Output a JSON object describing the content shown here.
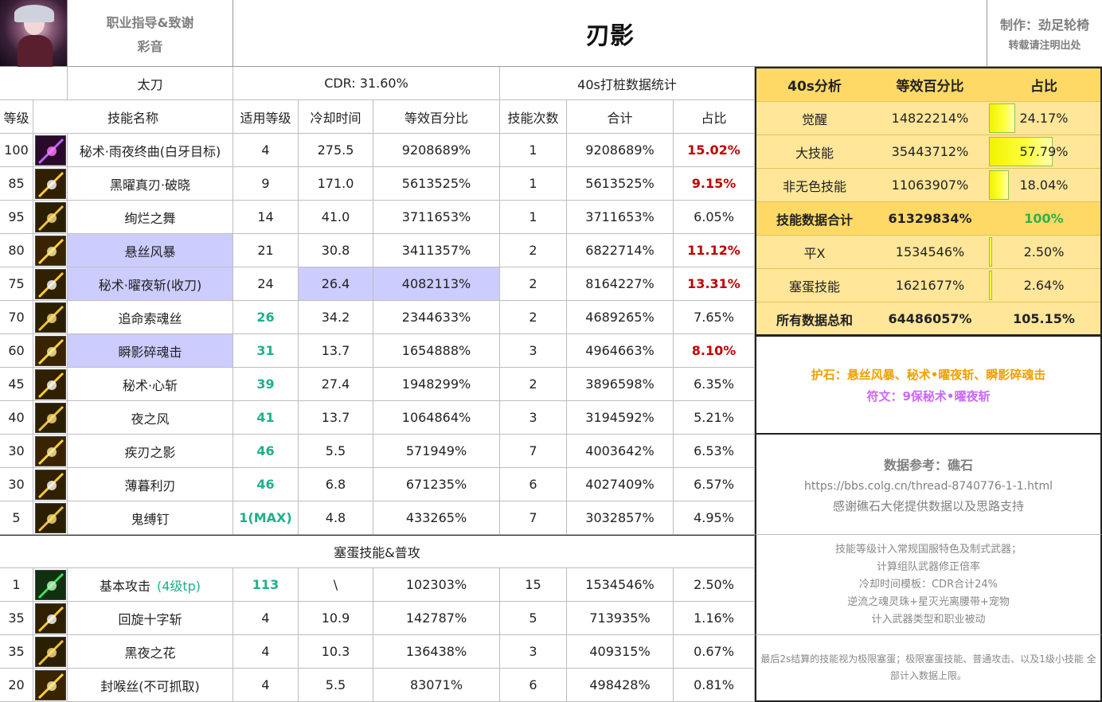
{
  "header": {
    "guide_line1": "职业指导&致谢",
    "guide_line2": "彩音",
    "title": "刃影",
    "author": "制作：劲足轮椅",
    "repost": "转载请注明出处"
  },
  "subheader": {
    "weapon": "太刀",
    "cdr": "CDR:   31.60%",
    "stats_title": "40s打桩数据统计"
  },
  "columns": [
    "等级",
    "技能名称",
    "适用等级",
    "冷却时间",
    "等效百分比",
    "技能次数",
    "合计",
    "占比"
  ],
  "skills": [
    {
      "level": "100",
      "name": "秘术·雨夜终曲(白牙目标)",
      "applicable": "4",
      "cd": "275.5",
      "pct": "9208689%",
      "count": "1",
      "total": "9208689%",
      "share": "15.02%",
      "icon": "slash-icon"
    },
    {
      "level": "85",
      "name": "黑曜真刃·破晓",
      "applicable": "9",
      "cd": "171.0",
      "pct": "5613525%",
      "count": "1",
      "total": "5613525%",
      "share": "9.15%",
      "icon": "sword-icon"
    },
    {
      "level": "95",
      "name": "绚烂之舞",
      "applicable": "14",
      "cd": "41.0",
      "pct": "3711653%",
      "count": "1",
      "total": "3711653%",
      "share": "6.05%",
      "icon": "dance-icon"
    },
    {
      "level": "80",
      "name": "悬丝风暴",
      "applicable": "21",
      "cd": "30.8",
      "pct": "3411357%",
      "count": "2",
      "total": "6822714%",
      "share": "11.12%",
      "icon": "storm-icon"
    },
    {
      "level": "75",
      "name": "秘术·曜夜斩(收刀)",
      "applicable": "24",
      "cd": "26.4",
      "pct": "4082113%",
      "count": "2",
      "total": "8164227%",
      "share": "13.31%",
      "icon": "night-slash-icon"
    },
    {
      "level": "70",
      "name": "追命索魂丝",
      "applicable": "26",
      "cd": "34.2",
      "pct": "2344633%",
      "count": "2",
      "total": "4689265%",
      "share": "7.65%",
      "icon": "thread-icon"
    },
    {
      "level": "60",
      "name": "瞬影碎魂击",
      "applicable": "31",
      "cd": "13.7",
      "pct": "1654888%",
      "count": "3",
      "total": "4964663%",
      "share": "8.10%",
      "icon": "burst-icon"
    },
    {
      "level": "45",
      "name": "秘术·心斩",
      "applicable": "39",
      "cd": "27.4",
      "pct": "1948299%",
      "count": "2",
      "total": "3896598%",
      "share": "6.35%",
      "icon": "heart-slash-icon"
    },
    {
      "level": "40",
      "name": "夜之风",
      "applicable": "41",
      "cd": "13.7",
      "pct": "1064864%",
      "count": "3",
      "total": "3194592%",
      "share": "5.21%",
      "icon": "wind-icon"
    },
    {
      "level": "30",
      "name": "疾刃之影",
      "applicable": "46",
      "cd": "5.5",
      "pct": "571949%",
      "count": "7",
      "total": "4003642%",
      "share": "6.53%",
      "icon": "shadow-blade-icon"
    },
    {
      "level": "30",
      "name": "薄暮利刃",
      "applicable": "46",
      "cd": "6.8",
      "pct": "671235%",
      "count": "6",
      "total": "4027409%",
      "share": "6.57%",
      "icon": "dusk-blade-icon"
    },
    {
      "level": "5",
      "name": "鬼缚钉",
      "applicable": "1(MAX)",
      "cd": "4.8",
      "pct": "433265%",
      "count": "7",
      "total": "3032857%",
      "share": "4.95%",
      "icon": "nail-icon"
    }
  ],
  "filler_title": "塞蛋技能&普攻",
  "filler": [
    {
      "level": "1",
      "name": "基本攻击",
      "tp": "(4级tp)",
      "applicable": "113",
      "cd": "\\",
      "pct": "102303%",
      "count": "15",
      "total": "1534546%",
      "share": "2.50%",
      "icon": "basic-attack-icon"
    },
    {
      "level": "35",
      "name": "回旋十字斩",
      "applicable": "4",
      "cd": "10.9",
      "pct": "142787%",
      "count": "5",
      "total": "713935%",
      "share": "1.16%",
      "icon": "cross-slash-icon"
    },
    {
      "level": "35",
      "name": "黑夜之花",
      "applicable": "4",
      "cd": "10.3",
      "pct": "136438%",
      "count": "3",
      "total": "409315%",
      "share": "0.67%",
      "icon": "night-flower-icon"
    },
    {
      "level": "20",
      "name": "封喉丝(不可抓取)",
      "applicable": "4",
      "cd": "5.5",
      "pct": "83071%",
      "count": "6",
      "total": "498428%",
      "share": "0.81%",
      "icon": "throat-thread-icon"
    }
  ],
  "analysis": {
    "headers": [
      "40s分析",
      "等效百分比",
      "占比"
    ],
    "rows": [
      {
        "label": "觉醒",
        "value": "14822214%",
        "share": "24.17%",
        "ratio": 0.2417
      },
      {
        "label": "大技能",
        "value": "35443712%",
        "share": "57.79%",
        "ratio": 0.5779
      },
      {
        "label": "非无色技能",
        "value": "11063907%",
        "share": "18.04%",
        "ratio": 0.1804
      }
    ],
    "total": {
      "label": "技能数据合计",
      "value": "61329834%",
      "share": "100%"
    },
    "extra": [
      {
        "label": "平X",
        "value": "1534546%",
        "share": "2.50%",
        "ratio": 0.025
      },
      {
        "label": "塞蛋技能",
        "value": "1621677%",
        "share": "2.64%",
        "ratio": 0.0264
      }
    ],
    "grand": {
      "label": "所有数据总和",
      "value": "64486057%",
      "share": "105.15%"
    }
  },
  "notes": {
    "stone": "护石：悬丝风暴、秘术•曜夜斩、瞬影碎魂击",
    "rune": "符文：9保秘术•曜夜斩",
    "ref_title": "数据参考：礁石",
    "ref_url": "https://bbs.colg.cn/thread-8740776-1-1.html",
    "ref_thanks": "感谢礁石大佬提供数据以及思路支持",
    "m1": "技能等级计入常规国服特色及制式武器；",
    "m2": "计算组队武器修正倍率",
    "m3": "冷却时间模板：CDR合计24%",
    "m4": "逆流之魂灵珠+星灭光离腰带+宠物",
    "m5": "计入武器类型和职业被动",
    "bottom": "最后2s结算的技能视为极限塞蛋；极限塞蛋技能、普通攻击、以及1级小技能 全部计入数据上限。"
  },
  "colors": {
    "highlight": "#ccccff",
    "analysis_bg": "#ffe699",
    "analysis_head": "#ffd966",
    "green": "#1fb08a",
    "red": "#c00000",
    "orange": "#f0a000",
    "purple": "#cc66ff"
  }
}
